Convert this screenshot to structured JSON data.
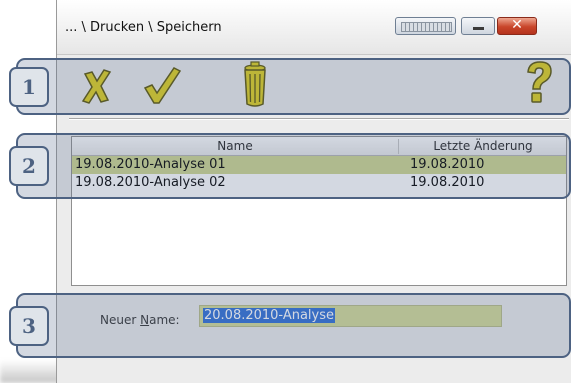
{
  "window": {
    "title": "... \\ Drucken \\ Speichern",
    "close_glyph": "✕"
  },
  "toolbar": {
    "tools": [
      "cancel-x-icon",
      "confirm-check-icon",
      "trash-icon",
      "help-question-icon"
    ]
  },
  "list": {
    "columns": [
      "Name",
      "Letzte Änderung"
    ],
    "rows": [
      {
        "name": "19.08.2010-Analyse 01",
        "date": "19.08.2010",
        "selected": true
      },
      {
        "name": "19.08.2010-Analyse 02",
        "date": "19.08.2010",
        "selected": false
      }
    ]
  },
  "form": {
    "label_pre": "Neuer ",
    "label_accel": "N",
    "label_post": "ame:",
    "value": "20.08.2010-Analyse"
  },
  "callouts": [
    "1",
    "2",
    "3"
  ],
  "colors": {
    "selection_row": "#cfd78f",
    "input_bg": "#d6dc98",
    "icon_yellow": "#e2d21b",
    "callout_border": "#4d6282"
  }
}
